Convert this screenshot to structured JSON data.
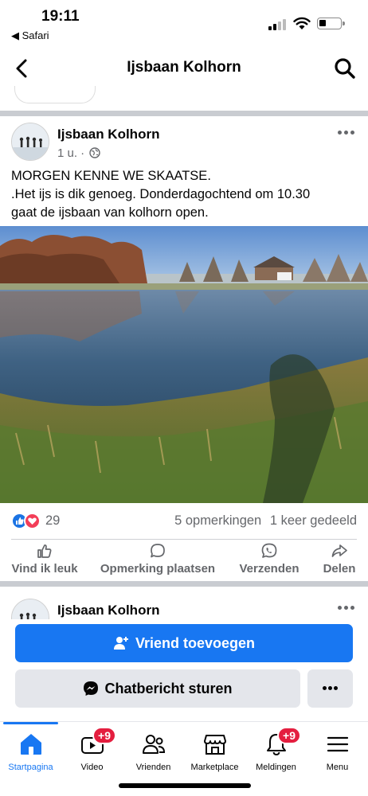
{
  "status_bar": {
    "time": "19:11",
    "back_app": "◀ Safari"
  },
  "header": {
    "title": "Ijsbaan Kolhorn",
    "back_icon": "chevron-left-icon",
    "search_icon": "search-icon"
  },
  "post": {
    "author": "Ijsbaan Kolhorn",
    "time_meta": "1 u. ·",
    "audience_icon": "globe-icon",
    "text_lines": [
      "MORGEN KENNE WE SKAATSE.",
      ".Het ijs is dik genoeg. Donderdagochtend om 10.30",
      "gaat de ijsbaan van kolhorn open."
    ],
    "reaction_count": "29",
    "comments": "5 opmerkingen",
    "shares": "1 keer gedeeld",
    "actions": {
      "like": "Vind ik leuk",
      "comment": "Opmerking plaatsen",
      "send": "Verzenden",
      "share": "Delen"
    }
  },
  "post2": {
    "author": "Ijsbaan Kolhorn"
  },
  "profile_actions": {
    "add_friend": "Vriend toevoegen",
    "message": "Chatbericht sturen"
  },
  "tabbar": {
    "items": [
      {
        "label": "Startpagina",
        "icon": "home-icon"
      },
      {
        "label": "Video",
        "icon": "video-icon",
        "badge": "+9"
      },
      {
        "label": "Vrienden",
        "icon": "friends-icon"
      },
      {
        "label": "Marketplace",
        "icon": "marketplace-icon"
      },
      {
        "label": "Meldingen",
        "icon": "bell-icon",
        "badge": "+9"
      },
      {
        "label": "Menu",
        "icon": "menu-icon"
      }
    ]
  },
  "colors": {
    "accent": "#1877f2",
    "badge": "#e41e3f",
    "secondary_text": "#65676b"
  }
}
